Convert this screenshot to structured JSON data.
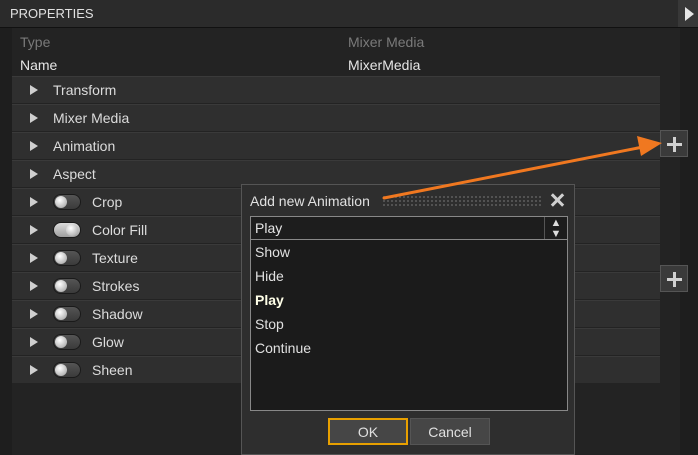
{
  "panel": {
    "title": "PROPERTIES"
  },
  "props": {
    "type_label": "Type",
    "type_value": "Mixer Media",
    "name_label": "Name",
    "name_value": "MixerMedia"
  },
  "sections": [
    {
      "label": "Transform"
    },
    {
      "label": "Mixer Media"
    },
    {
      "label": "Animation"
    },
    {
      "label": "Aspect"
    },
    {
      "label": "Crop",
      "toggle": "off"
    },
    {
      "label": "Color Fill",
      "toggle": "on"
    },
    {
      "label": "Texture",
      "toggle": "off"
    },
    {
      "label": "Strokes",
      "toggle": "off"
    },
    {
      "label": "Shadow",
      "toggle": "off"
    },
    {
      "label": "Glow",
      "toggle": "off"
    },
    {
      "label": "Sheen",
      "toggle": "off"
    }
  ],
  "dialog": {
    "title": "Add new Animation",
    "selected": "Play",
    "options": [
      "Show",
      "Hide",
      "Play",
      "Stop",
      "Continue"
    ],
    "ok_label": "OK",
    "cancel_label": "Cancel"
  },
  "colors": {
    "annotation_arrow": "#f07820",
    "ok_border": "#e8a000"
  }
}
